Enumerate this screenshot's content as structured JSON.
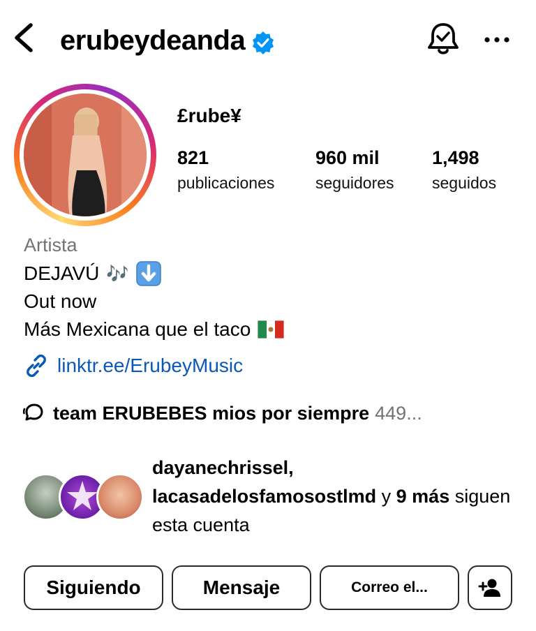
{
  "header": {
    "username": "erubeydeanda",
    "back_icon": "chevron-left-icon",
    "verified_icon": "verified-badge-icon",
    "bell_icon": "notification-bell-icon",
    "more_icon": "more-horizontal-icon"
  },
  "profile": {
    "display_name": "£rube¥",
    "stats": [
      {
        "value": "821",
        "label": "publicaciones"
      },
      {
        "value": "960 mil",
        "label": "seguidores"
      },
      {
        "value": "1,498",
        "label": "seguidos"
      }
    ]
  },
  "bio": {
    "category": "Artista",
    "line1": "DEJAVÚ",
    "line1_emoji": "🎶",
    "line2": "Out now",
    "line3": "Más Mexicana que el taco",
    "link": "linktr.ee/ErubeyMusic"
  },
  "channel": {
    "name": "team ERUBEBES mios por siempre",
    "count": "449..."
  },
  "followed_by": {
    "user1": "dayanechrissel,",
    "user2": "lacasadelosfamosostlmd",
    "joiner": " y ",
    "more": "9 más",
    "suffix": " siguen esta cuenta"
  },
  "actions": {
    "following_label": "Siguiendo",
    "message_label": "Mensaje",
    "email_label": "Correo el..."
  },
  "colors": {
    "link": "#0a59b8",
    "verified": "#0095f6",
    "muted": "#737373"
  }
}
